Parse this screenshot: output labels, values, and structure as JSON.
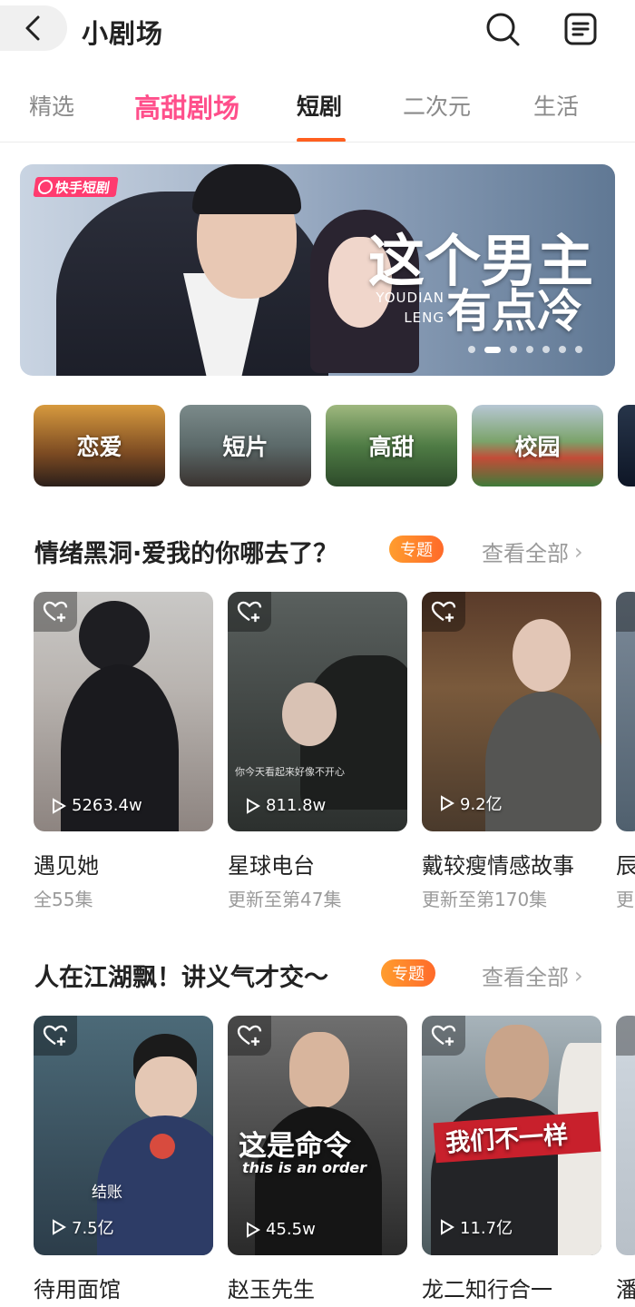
{
  "header": {
    "title": "小剧场"
  },
  "tabs": [
    {
      "label": "精选"
    },
    {
      "label": "高甜剧场"
    },
    {
      "label": "短剧"
    },
    {
      "label": "二次元"
    },
    {
      "label": "生活"
    }
  ],
  "banner": {
    "brand": "快手短剧",
    "title_line1": "这个男主",
    "title_line2": "有点冷",
    "pinyin_line1": "YOUDIAN",
    "pinyin_line2": "LENG",
    "dots_count": 7,
    "active_dot_index": 1
  },
  "categories": [
    {
      "label": "恋爱"
    },
    {
      "label": "短片"
    },
    {
      "label": "高甜"
    },
    {
      "label": "校园"
    }
  ],
  "section1": {
    "title": "情绪黑洞·爱我的你哪去了？",
    "badge": "专题",
    "view_all": "查看全部",
    "cards": [
      {
        "title": "遇见她",
        "subtitle": "全55集",
        "plays": "5263.4w",
        "caption": ""
      },
      {
        "title": "星球电台",
        "subtitle": "更新至第47集",
        "plays": "811.8w",
        "caption": "你今天看起来好像不开心"
      },
      {
        "title": "戴较瘦情感故事",
        "subtitle": "更新至第170集",
        "plays": "9.2亿",
        "caption": ""
      },
      {
        "title": "辰",
        "subtitle": "更",
        "plays": "",
        "caption": ""
      }
    ]
  },
  "section2": {
    "title": "人在江湖飘！讲义气才交～",
    "badge": "专题",
    "view_all": "查看全部",
    "cards": [
      {
        "title": "待用面馆",
        "plays": "7.5亿",
        "overlay": "结账"
      },
      {
        "title": "赵玉先生",
        "plays": "45.5w",
        "overlay": "这是命令",
        "overlay_sub": "this is an order"
      },
      {
        "title": "龙二知行合一",
        "plays": "11.7亿",
        "overlay": "我们不一样"
      },
      {
        "title": "潘",
        "plays": "",
        "overlay": ""
      }
    ]
  },
  "colors": {
    "accent_orange": "#ff5f1f",
    "pink_tab": "#ff4f8b",
    "badge_orange": "#ff7a2a"
  }
}
